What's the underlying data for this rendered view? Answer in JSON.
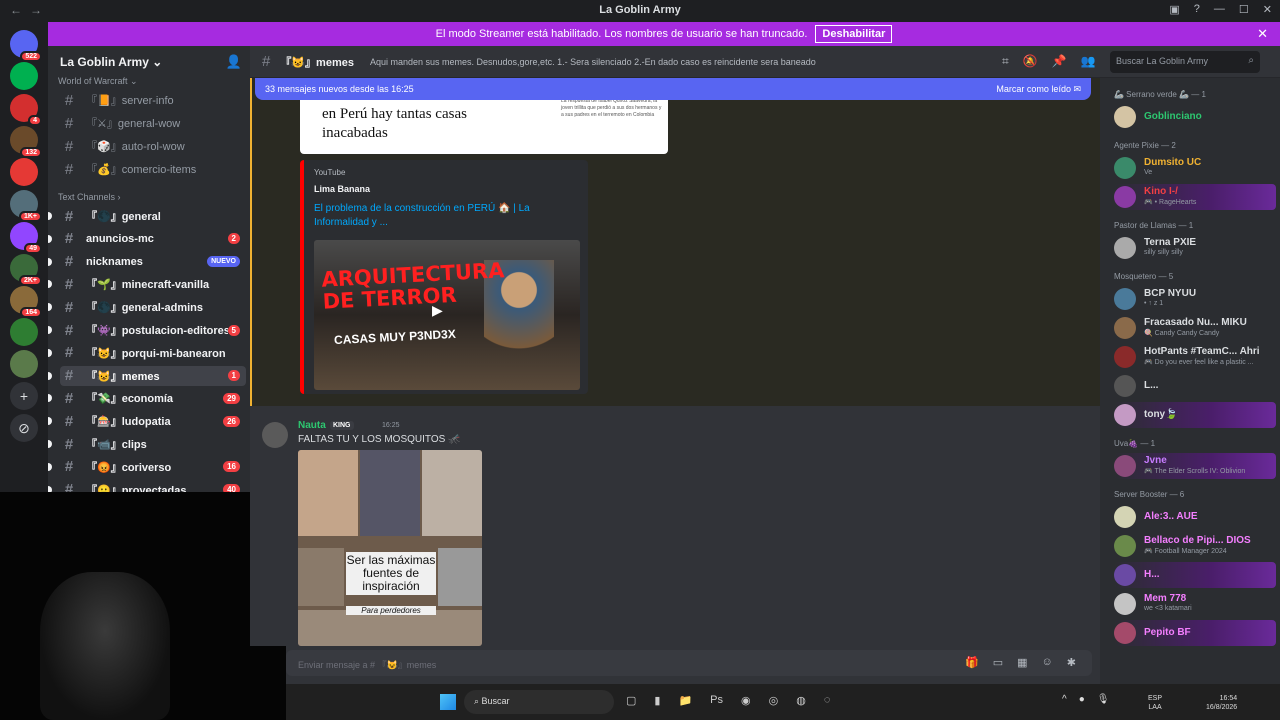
{
  "window": {
    "title": "La Goblin Army"
  },
  "banner": {
    "text": "El modo Streamer está habilitado. Los nombres de usuario se han truncado.",
    "button": "Deshabilitar"
  },
  "servers": [
    {
      "badge": "522",
      "color": "#5865f2"
    },
    {
      "badge": "",
      "color": "#00b050"
    },
    {
      "badge": "4",
      "color": "#d32f2f"
    },
    {
      "badge": "132",
      "color": "#6a4a2a"
    },
    {
      "badge": "",
      "color": "#e53935"
    },
    {
      "badge": "1K+",
      "color": "#546e7a"
    },
    {
      "badge": "49",
      "color": "#9146ff"
    },
    {
      "badge": "2K+",
      "color": "#3a6a3a"
    },
    {
      "badge": "164",
      "color": "#8a6a3a"
    },
    {
      "badge": "",
      "color": "#2e7d32"
    },
    {
      "badge": "",
      "color": "#5a7a4a"
    }
  ],
  "sidebar": {
    "server_name": "La Goblin Army",
    "category_top": "World of Warcraft",
    "wow_channels": [
      "『📙』server-info",
      "『⚔』general-wow",
      "『🎲』auto-rol-wow",
      "『💰』comercio-items"
    ],
    "category": "Text Channels",
    "channels": [
      {
        "name": "『🌑』general",
        "count": "",
        "bright": true
      },
      {
        "name": "anuncios-mc",
        "count": "2",
        "bright": true
      },
      {
        "name": "nicknames",
        "count": "",
        "new": "NUEVO",
        "bright": true
      },
      {
        "name": "『🌱』minecraft-vanilla",
        "count": "",
        "bright": true
      },
      {
        "name": "『🌑』general-admins",
        "count": "",
        "bright": true
      },
      {
        "name": "『👾』postulacion-editores",
        "count": "5",
        "bright": true
      },
      {
        "name": "『😺』porqui-mi-banearon",
        "count": "",
        "bright": true
      },
      {
        "name": "『😺』memes",
        "count": "1",
        "bright": true,
        "active": true
      },
      {
        "name": "『💸』economía",
        "count": "29",
        "bright": true
      },
      {
        "name": "『🎰』ludopatia",
        "count": "26",
        "bright": true
      },
      {
        "name": "『📹』clips",
        "count": "",
        "bright": true
      },
      {
        "name": "『😡』coriverso",
        "count": "16",
        "bright": true
      },
      {
        "name": "『😐』proyectadas",
        "count": "40",
        "bright": true
      }
    ]
  },
  "header": {
    "channel": "『😺』memes",
    "topic": "Aqui manden sus memes. Desnudos,gore,etc. 1.- Sera silenciado 2.-En dado caso es reincidente sera baneado",
    "search_placeholder": "Buscar La Goblin Army"
  },
  "chat": {
    "new_messages": "33 mensajes nuevos desde las 16:25",
    "mark_read": "Marcar como leído",
    "news_headline": "en Perú hay tantas casas inacabadas",
    "news_side": "La respuesta de Isabel Quiroz Saavedra, la joven trillita que perdió a sus dos hermanos y a sus padres en el terremoto en Colombia",
    "embed": {
      "provider": "YouTube",
      "author": "Lima Banana",
      "title": "El problema de la construcción en PERÚ 🏠 | La Informalidad y ...",
      "thumb_line1": "ARQUITECTURA",
      "thumb_line2": "DE TERROR",
      "thumb_line3": "CASAS MUY P3ND3X"
    },
    "message": {
      "author": "Nauta",
      "tag": "KING",
      "time": "16:25",
      "text": "FALTAS TU Y LOS MOSQUITOS 🦟",
      "caption": "Ser las máximas fuentes de inspiración",
      "caption2": "Para perdedores"
    },
    "composer_placeholder": "Enviar mensaje a # 『😺』memes"
  },
  "members": {
    "groups": [
      {
        "title": "🦾 Serrano verde 🦾 — 1",
        "members": [
          {
            "name": "Goblinciano",
            "status": "",
            "color": "#2dc770"
          }
        ]
      },
      {
        "title": "Agente Pixie — 2",
        "members": [
          {
            "name": "Dumsito",
            "status": "Ve",
            "color": "#f0b232",
            "tag": "UC"
          },
          {
            "name": "Kino",
            "status": "🎮 • RageHearts",
            "color": "#f23f43",
            "tag": "I-/",
            "hl": true
          }
        ]
      },
      {
        "title": "Pastor de Llamas — 1",
        "members": [
          {
            "name": "Terna",
            "status": "silly silly silly",
            "color": "#dbdee1",
            "tag": "PXIE"
          }
        ]
      },
      {
        "title": "Mosquetero — 5",
        "members": [
          {
            "name": "BCP",
            "status": "• ↑ z 1",
            "color": "#dbdee1",
            "tag": "NYUU"
          },
          {
            "name": "Fracasado Nu...",
            "status": "🍭 Candy Candy Candy",
            "color": "#dbdee1",
            "tag": "MIKU"
          },
          {
            "name": "HotPants #TeamC...",
            "status": "🎮 Do you ever feel like a plastic ...",
            "color": "#dbdee1",
            "tag": "Ahri"
          },
          {
            "name": "L...",
            "status": "",
            "color": "#dbdee1"
          },
          {
            "name": "tony🍃",
            "status": "",
            "color": "#dbdee1",
            "hl": true
          }
        ]
      },
      {
        "title": "Uva🍇 — 1",
        "members": [
          {
            "name": "Jvne",
            "status": "🎮 The Elder Scrolls IV: Oblivion",
            "color": "#c77dff",
            "hl": true
          }
        ]
      },
      {
        "title": "Server Booster — 6",
        "members": [
          {
            "name": "Ale:3..",
            "status": "",
            "color": "#f47fff",
            "tag": "AUE"
          },
          {
            "name": "Bellaco de Pipi...",
            "status": "🎮 Football Manager 2024",
            "color": "#f47fff",
            "tag": "DIOS"
          },
          {
            "name": "H...",
            "status": "",
            "color": "#f47fff",
            "hl": true
          },
          {
            "name": "Mem",
            "status": "we <3 katamari",
            "color": "#f47fff",
            "tag": "778"
          },
          {
            "name": "Pepito",
            "status": "",
            "color": "#f47fff",
            "tag": "BF",
            "hl": true
          }
        ]
      }
    ]
  },
  "taskbar": {
    "search": "Buscar",
    "lang1": "ESP",
    "lang2": "LAA",
    "time": "16:54",
    "date": "16/8/2026"
  }
}
